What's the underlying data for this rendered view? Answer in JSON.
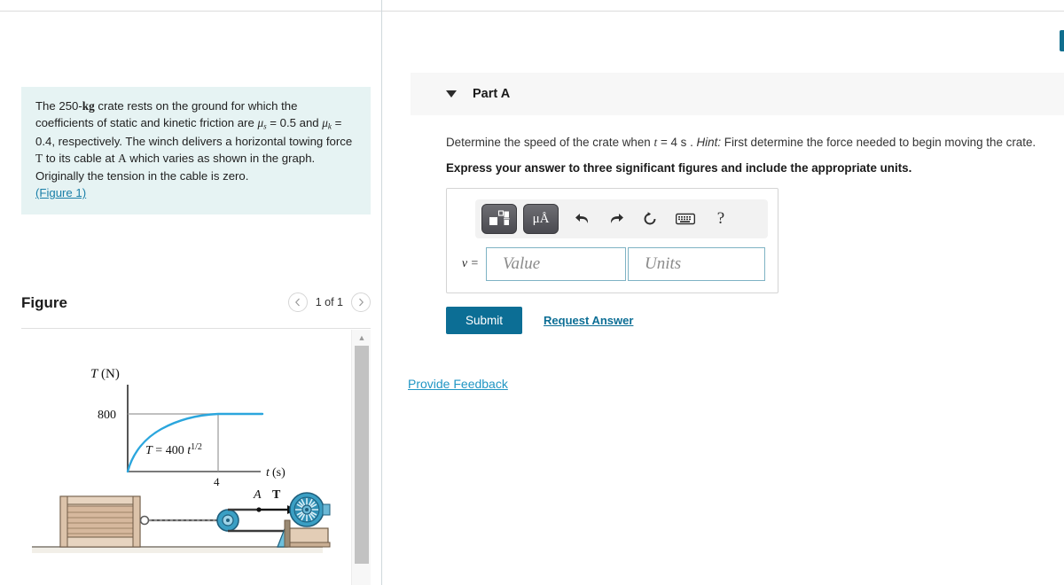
{
  "question": {
    "line1_pre": "The 250-",
    "line1_kg": "kg",
    "line1_post": " crate rests on the ground for which the coefficients of static and kinetic friction are ",
    "mu_s": "μ",
    "mu_s_sub": "s",
    "mu_s_val": " = 0.5 and ",
    "mu_k": "μ",
    "mu_k_sub": "k",
    "mu_k_val": " = 0.4, respectively. The winch delivers a horizontal towing force ",
    "T_symbol": "T",
    "after_T": " to its cable at ",
    "A_symbol": "A",
    "after_A": " which varies as shown in the graph. Originally the tension in the cable is zero.",
    "figure_link": "(Figure 1)"
  },
  "figure_panel": {
    "title": "Figure",
    "prev_icon": "chevron-left-icon",
    "next_icon": "chevron-right-icon",
    "counter": "1 of 1",
    "scroll_up_icon": "triangle-up-icon"
  },
  "part": {
    "caret_icon": "caret-down-icon",
    "title": "Part A",
    "prompt_a": "Determine the speed of the crate when ",
    "prompt_t": "t",
    "prompt_b": " = 4  s . ",
    "prompt_hint_label": "Hint:",
    "prompt_hint": " First determine the force needed to begin moving the crate.",
    "express": "Express your answer to three significant figures and include the appropriate units."
  },
  "answer": {
    "toolbar": [
      {
        "name": "math-template-icon",
        "glyph": "",
        "type": "button"
      },
      {
        "name": "units-icon",
        "glyph": "μÅ",
        "type": "button"
      },
      {
        "name": "undo-icon",
        "glyph": "↶",
        "type": "icon"
      },
      {
        "name": "redo-icon",
        "glyph": "↷",
        "type": "icon"
      },
      {
        "name": "reset-icon",
        "glyph": "↺",
        "type": "icon"
      },
      {
        "name": "keyboard-icon",
        "glyph": "⌨",
        "type": "icon"
      },
      {
        "name": "help-icon",
        "glyph": "?",
        "type": "icon"
      }
    ],
    "variable_label": "v =",
    "value_placeholder": "Value",
    "units_placeholder": "Units",
    "submit_label": "Submit",
    "request_answer_label": "Request Answer"
  },
  "feedback": {
    "label": "Provide Feedback"
  },
  "colors": {
    "accent_teal": "#0c6e95",
    "link_blue": "#2196c4",
    "question_bg": "#e6f3f3",
    "part_header_bg": "#f7f7f7",
    "curve_blue": "#2ba6dd"
  },
  "chart_data": {
    "type": "line",
    "title": "",
    "xlabel": "t (s)",
    "ylabel": "T (N)",
    "annotation": "T = 400 t",
    "annotation_exponent": "1/2",
    "x_ticks": [
      "4"
    ],
    "y_ticks": [
      "800"
    ],
    "xlim": [
      0,
      9
    ],
    "ylim": [
      0,
      950
    ],
    "grid": false,
    "x": [
      0,
      0.25,
      0.5,
      1,
      1.5,
      2,
      2.5,
      3,
      3.5,
      4,
      5,
      6,
      7,
      8,
      9
    ],
    "y": [
      0,
      200,
      283,
      400,
      490,
      566,
      632,
      693,
      748,
      800,
      800,
      800,
      800,
      800,
      800
    ],
    "notes": "T = 400*t^(1/2) for t <= 4 s; constant at 800 N thereafter"
  },
  "diagram": {
    "label_A": "A",
    "label_T": "T",
    "crate_fill": "#ddc4ae",
    "pulley_fill": "#3a9fc4",
    "ground_color": "#8a8274"
  }
}
